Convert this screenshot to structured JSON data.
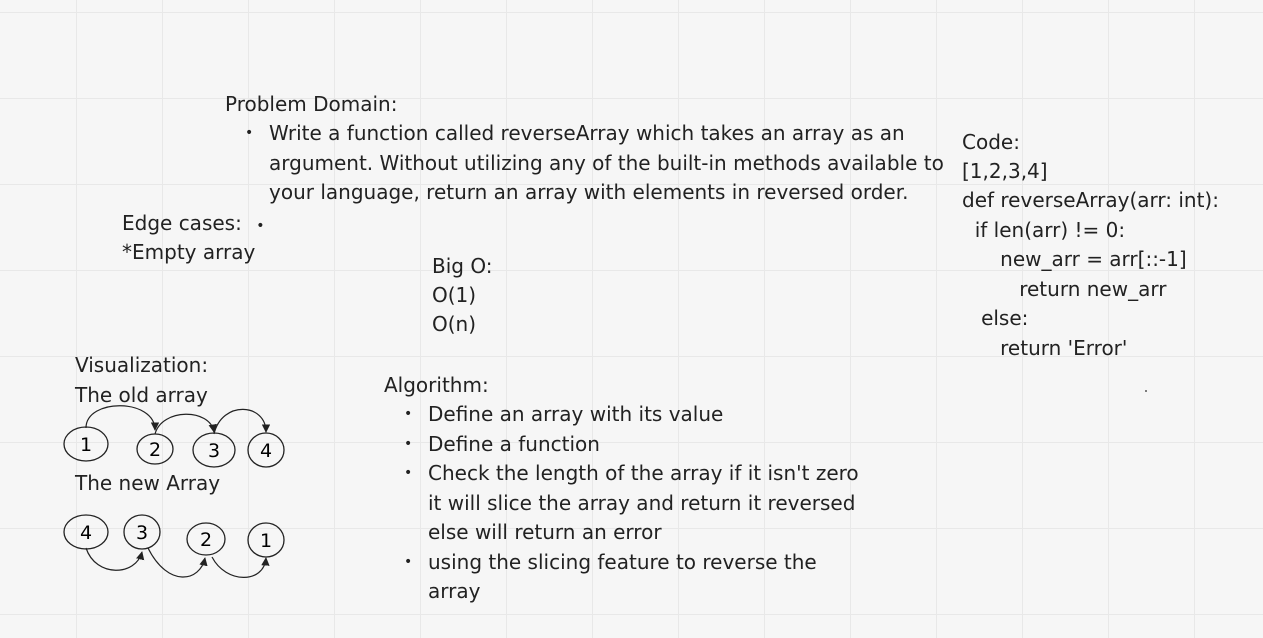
{
  "problem": {
    "heading": "Problem Domain:",
    "bullets": [
      "Write a function called reverseArray which takes an array as an argument. Without utilizing any of the built-in methods available to your language, return an array with elements in reversed order."
    ]
  },
  "edge_cases": {
    "heading": "Edge cases:",
    "bullet": "•",
    "items": [
      "*Empty array"
    ]
  },
  "big_o": {
    "heading": "Big O:",
    "lines": [
      "O(1)",
      "O(n)"
    ]
  },
  "code": {
    "heading": "Code:",
    "lines": [
      "[1,2,3,4]",
      "def reverseArray(arr: int):",
      "  if len(arr) != 0:",
      "      new_arr = arr[::-1]",
      "         return new_arr",
      "   else:",
      "      return 'Error'"
    ]
  },
  "visualization": {
    "heading": "Visualization:",
    "old_label": "The old array",
    "new_label": "The new Array",
    "old_nodes": [
      "1",
      "2",
      "3",
      "4"
    ],
    "new_nodes": [
      "4",
      "3",
      "2",
      "1"
    ]
  },
  "algorithm": {
    "heading": "Algorithm:",
    "bullets": [
      "Define an array with its value",
      "Define a function",
      "Check the length of the array if it isn't zero it will slice the array and return it reversed else will return an error",
      "using the slicing feature to reverse the array"
    ]
  }
}
